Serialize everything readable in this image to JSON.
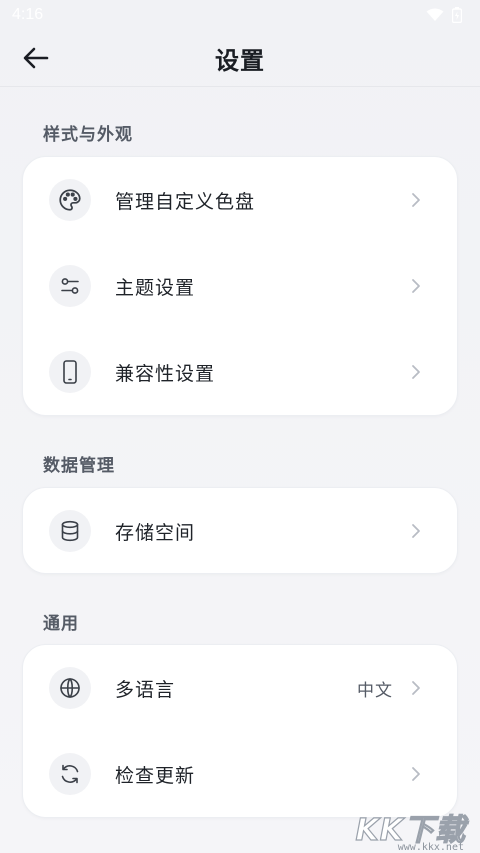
{
  "status_bar": {
    "time": "4:16"
  },
  "header": {
    "title": "设置"
  },
  "sections": [
    {
      "title": "样式与外观",
      "items": [
        {
          "label": "管理自定义色盘",
          "icon": "palette-icon"
        },
        {
          "label": "主题设置",
          "icon": "sliders-icon"
        },
        {
          "label": "兼容性设置",
          "icon": "phone-icon"
        }
      ]
    },
    {
      "title": "数据管理",
      "items": [
        {
          "label": "存储空间",
          "icon": "database-icon"
        }
      ]
    },
    {
      "title": "通用",
      "items": [
        {
          "label": "多语言",
          "icon": "globe-icon",
          "value": "中文"
        },
        {
          "label": "检查更新",
          "icon": "refresh-icon"
        }
      ]
    }
  ],
  "watermark": {
    "text": "KK下载",
    "url": "www.kkx.net"
  },
  "colors": {
    "icon_stroke": "#3b4048",
    "chevron": "#b8bcc4",
    "card_bg": "#ffffff"
  }
}
